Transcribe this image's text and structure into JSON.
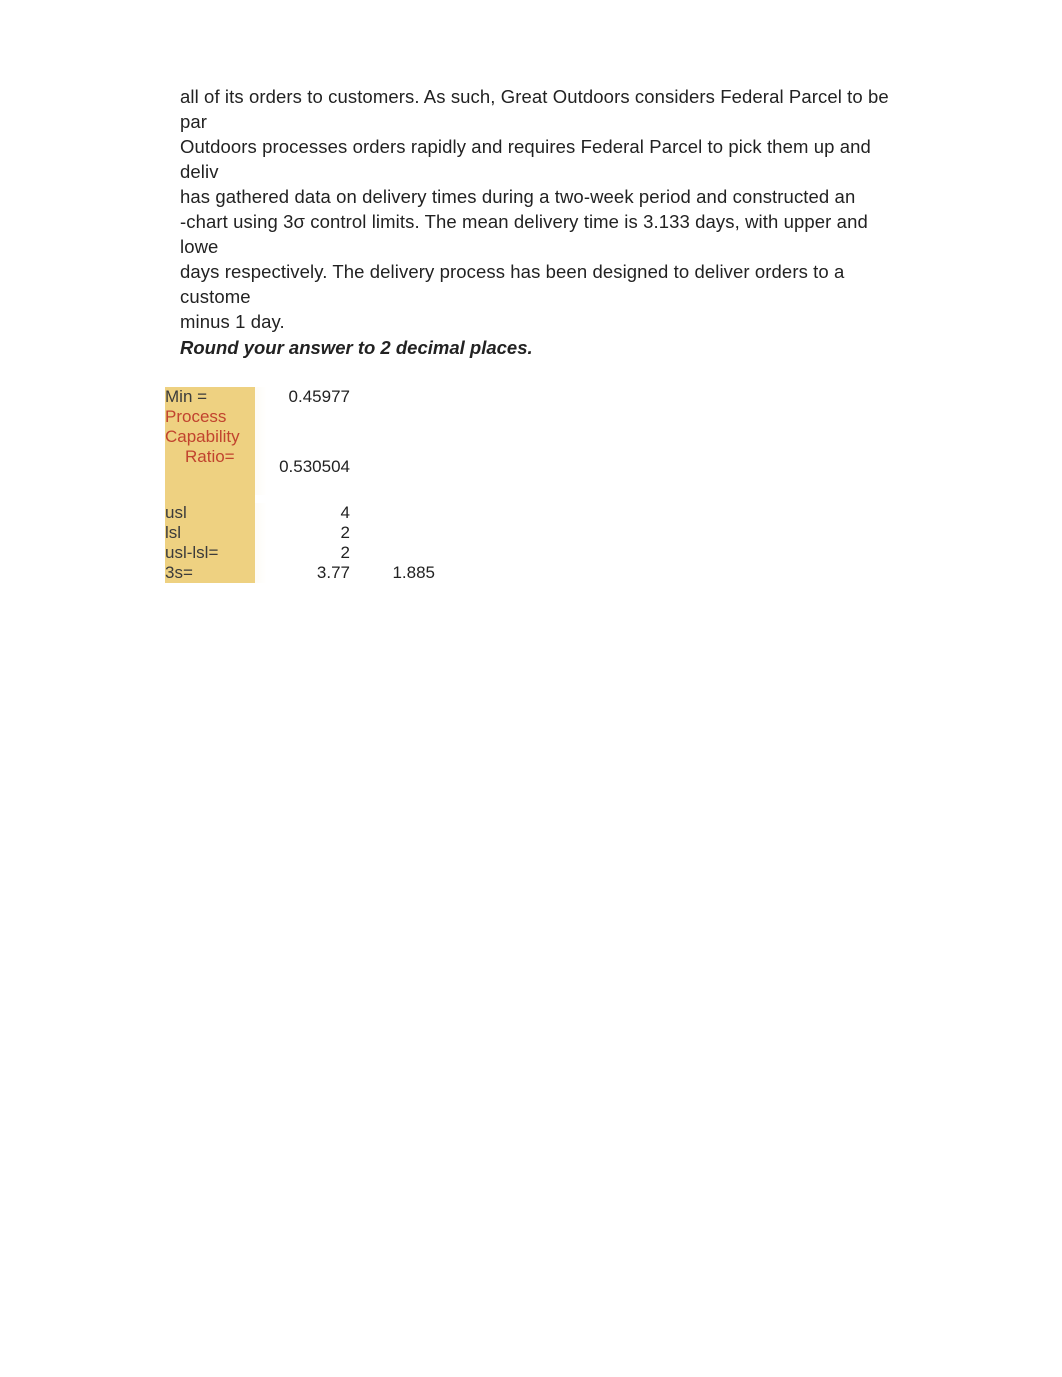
{
  "paragraph": {
    "line1": "all of its orders to customers. As such, Great Outdoors considers Federal Parcel to be par",
    "line2": "Outdoors processes orders rapidly and requires Federal Parcel to pick them up and deliv",
    "line3": "has gathered data on delivery times during a two-week period and constructed an",
    "line4": "-chart using 3σ control limits. The mean delivery time is 3.133 days, with upper and lowe",
    "line5": "days respectively. The delivery process has been designed to deliver orders to a custome",
    "line6": "minus 1 day."
  },
  "instruction": "Round your answer to 2 decimal places.",
  "table": {
    "rows": [
      {
        "label": "Min =",
        "value": "0.45977",
        "extra": ""
      },
      {
        "label_html": "Process\nCapability\nRatio=",
        "value": "0.530504",
        "extra": ""
      },
      {
        "label": "usl",
        "value": "4",
        "extra": ""
      },
      {
        "label": "lsl",
        "value": "2",
        "extra": ""
      },
      {
        "label": "usl-lsl=",
        "value": "2",
        "extra": ""
      },
      {
        "label": "3s=",
        "value": "3.77",
        "extra": "1.885"
      }
    ]
  }
}
